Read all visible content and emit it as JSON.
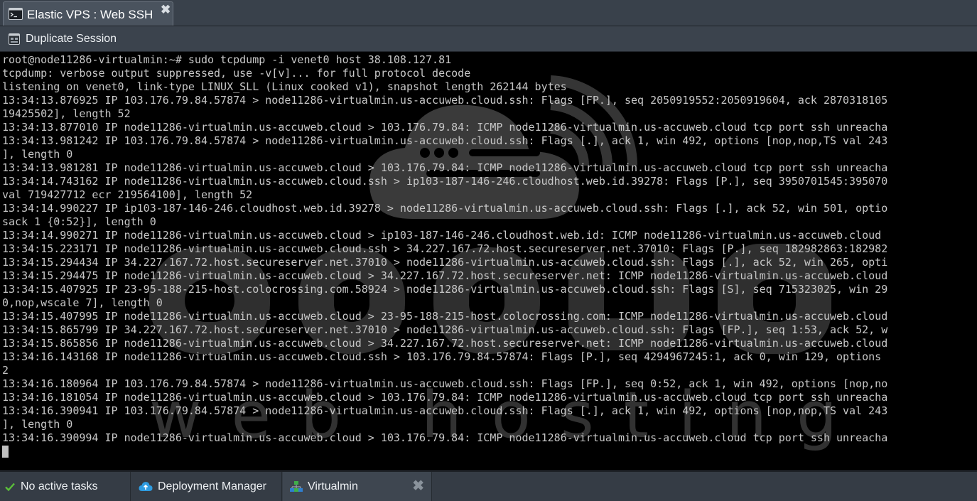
{
  "window": {
    "tab_title": "Elastic VPS : Web SSH",
    "close_glyph": "✖"
  },
  "toolbar": {
    "duplicate_label": "Duplicate Session"
  },
  "terminal": {
    "lines": [
      "root@node11286-virtualmin:~# sudo tcpdump -i venet0 host 38.108.127.81",
      "tcpdump: verbose output suppressed, use -v[v]... for full protocol decode",
      "listening on venet0, link-type LINUX_SLL (Linux cooked v1), snapshot length 262144 bytes",
      "13:34:13.876925 IP 103.176.79.84.57874 > node11286-virtualmin.us-accuweb.cloud.ssh: Flags [FP.], seq 2050919552:2050919604, ack 2870318105",
      "19425502], length 52",
      "13:34:13.877010 IP node11286-virtualmin.us-accuweb.cloud > 103.176.79.84: ICMP node11286-virtualmin.us-accuweb.cloud tcp port ssh unreacha",
      "13:34:13.981242 IP 103.176.79.84.57874 > node11286-virtualmin.us-accuweb.cloud.ssh: Flags [.], ack 1, win 492, options [nop,nop,TS val 243",
      "], length 0",
      "13:34:13.981281 IP node11286-virtualmin.us-accuweb.cloud > 103.176.79.84: ICMP node11286-virtualmin.us-accuweb.cloud tcp port ssh unreacha",
      "13:34:14.743162 IP node11286-virtualmin.us-accuweb.cloud.ssh > ip103-187-146-246.cloudhost.web.id.39278: Flags [P.], seq 3950701545:395070",
      "val 719427712 ecr 219564100], length 52",
      "13:34:14.990227 IP ip103-187-146-246.cloudhost.web.id.39278 > node11286-virtualmin.us-accuweb.cloud.ssh: Flags [.], ack 52, win 501, optio",
      "sack 1 {0:52}], length 0",
      "13:34:14.990271 IP node11286-virtualmin.us-accuweb.cloud > ip103-187-146-246.cloudhost.web.id: ICMP node11286-virtualmin.us-accuweb.cloud",
      "13:34:15.223171 IP node11286-virtualmin.us-accuweb.cloud.ssh > 34.227.167.72.host.secureserver.net.37010: Flags [P.], seq 182982863:182982",
      "13:34:15.294434 IP 34.227.167.72.host.secureserver.net.37010 > node11286-virtualmin.us-accuweb.cloud.ssh: Flags [.], ack 52, win 265, opti",
      "13:34:15.294475 IP node11286-virtualmin.us-accuweb.cloud > 34.227.167.72.host.secureserver.net: ICMP node11286-virtualmin.us-accuweb.cloud",
      "13:34:15.407925 IP 23-95-188-215-host.colocrossing.com.58924 > node11286-virtualmin.us-accuweb.cloud.ssh: Flags [S], seq 715323025, win 29",
      "0,nop,wscale 7], length 0",
      "13:34:15.407995 IP node11286-virtualmin.us-accuweb.cloud > 23-95-188-215-host.colocrossing.com: ICMP node11286-virtualmin.us-accuweb.cloud",
      "13:34:15.865799 IP 34.227.167.72.host.secureserver.net.37010 > node11286-virtualmin.us-accuweb.cloud.ssh: Flags [FP.], seq 1:53, ack 52, w",
      "13:34:15.865856 IP node11286-virtualmin.us-accuweb.cloud > 34.227.167.72.host.secureserver.net: ICMP node11286-virtualmin.us-accuweb.cloud",
      "13:34:16.143168 IP node11286-virtualmin.us-accuweb.cloud.ssh > 103.176.79.84.57874: Flags [P.], seq 4294967245:1, ack 0, win 129, options",
      "2",
      "13:34:16.180964 IP 103.176.79.84.57874 > node11286-virtualmin.us-accuweb.cloud.ssh: Flags [FP.], seq 0:52, ack 1, win 492, options [nop,no",
      "13:34:16.181054 IP node11286-virtualmin.us-accuweb.cloud > 103.176.79.84: ICMP node11286-virtualmin.us-accuweb.cloud tcp port ssh unreacha",
      "13:34:16.390941 IP 103.176.79.84.57874 > node11286-virtualmin.us-accuweb.cloud.ssh: Flags [.], ack 1, win 492, options [nop,nop,TS val 243",
      "], length 0",
      "13:34:16.390994 IP node11286-virtualmin.us-accuweb.cloud > 103.176.79.84: ICMP node11286-virtualmin.us-accuweb.cloud tcp port ssh unreacha"
    ]
  },
  "statusbar": {
    "tasks_label": "No active tasks",
    "deploy_label": "Deployment Manager",
    "virtualmin_label": "Virtualmin",
    "close_glyph": "✖"
  },
  "icons": {
    "tab": "terminal-icon",
    "duplicate": "duplicate-icon",
    "tasks": "checkmark-icon",
    "deploy": "cloud-upload-icon",
    "virtualmin": "network-icon",
    "watermark": "accuweb-logo"
  },
  "colors": {
    "terminal_bg": "#000000",
    "terminal_fg": "#c7c7c7",
    "chrome_bg": "#39414b",
    "check_green": "#5bbf3a",
    "cloud_blue": "#2e9be0",
    "network_green": "#3fae49",
    "network_blue": "#2f7fd0"
  }
}
